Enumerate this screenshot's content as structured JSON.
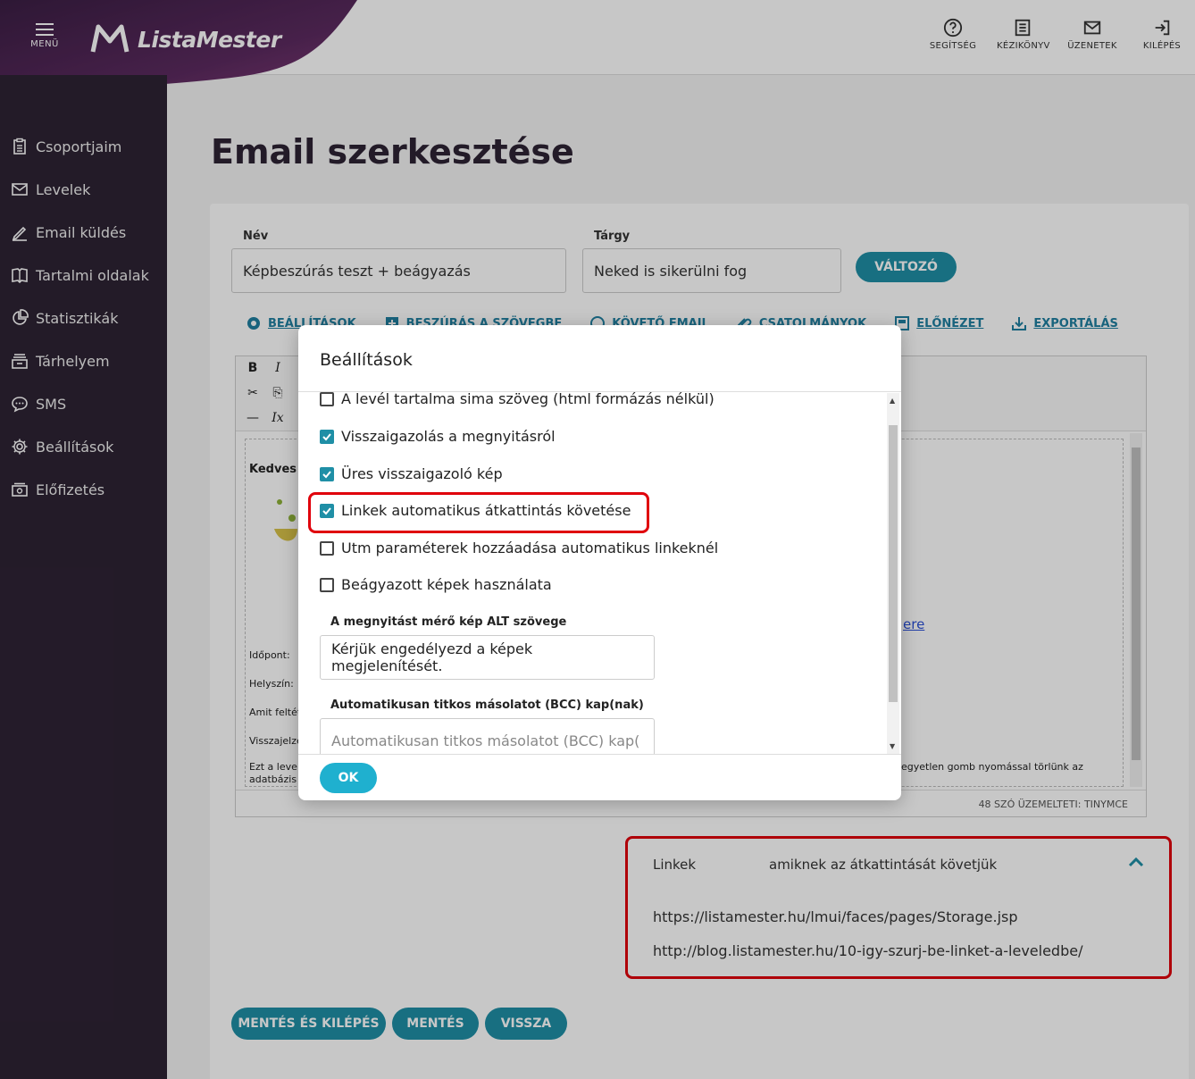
{
  "header": {
    "menu_label": "MENÜ",
    "brand": "ListaMester",
    "actions": [
      {
        "label": "SEGÍTSÉG",
        "icon": "help-icon"
      },
      {
        "label": "KÉZIKÖNYV",
        "icon": "manual-icon"
      },
      {
        "label": "ÜZENETEK",
        "icon": "messages-icon"
      },
      {
        "label": "KILÉPÉS",
        "icon": "logout-icon"
      }
    ]
  },
  "sidebar": {
    "items": [
      {
        "label": "Csoportjaim",
        "icon": "clipboard-icon"
      },
      {
        "label": "Levelek",
        "icon": "mail-icon"
      },
      {
        "label": "Email küldés",
        "icon": "pen-icon"
      },
      {
        "label": "Tartalmi oldalak",
        "icon": "book-icon"
      },
      {
        "label": "Statisztikák",
        "icon": "pie-chart-icon"
      },
      {
        "label": "Tárhelyem",
        "icon": "storage-icon"
      },
      {
        "label": "SMS",
        "icon": "chat-icon"
      },
      {
        "label": "Beállítások",
        "icon": "gear-icon"
      },
      {
        "label": "Előfizetés",
        "icon": "cash-icon"
      }
    ]
  },
  "main": {
    "title": "Email szerkesztése",
    "name_label": "Név",
    "name_value": "Képbeszúrás teszt + beágyazás",
    "subject_label": "Tárgy",
    "subject_value": "Neked is sikerülni fog",
    "variable_button": "VÁLTOZÓ",
    "tabs": [
      {
        "label": "BEÁLLÍTÁSOK",
        "icon": "gear-icon"
      },
      {
        "label": "BESZÚRÁS A SZÖVEGBE",
        "icon": "insert-icon"
      },
      {
        "label": "KÖVETŐ EMAIL",
        "icon": "follow-icon"
      },
      {
        "label": "CSATOLMÁNYOK",
        "icon": "attachment-icon"
      },
      {
        "label": "ELŐNÉZET",
        "icon": "preview-icon"
      },
      {
        "label": "EXPORTÁLÁS",
        "icon": "export-icon"
      }
    ],
    "editor": {
      "greeting": "Kedves [",
      "lines": [
        "Időpont:",
        "Helyszín:",
        "Amit feltét",
        "Visszajelzé"
      ],
      "footer_left": "Ezt a leve",
      "footer_left2": "adatbázis",
      "footer_right": "egyetlen gomb nyomással törlünk az",
      "link_fragment": "ere",
      "status": "48 SZÓ ÜZEMELTETI: TINYMCE"
    },
    "links_panel": {
      "title": "Linkek",
      "subtitle": "amiknek az átkattintását követjük",
      "urls": [
        "https://listamester.hu/lmui/faces/pages/Storage.jsp",
        "http://blog.listamester.hu/10-igy-szurj-be-linket-a-leveledbe/"
      ]
    },
    "buttons": {
      "save_exit": "MENTÉS ÉS KILÉPÉS",
      "save": "MENTÉS",
      "back": "VISSZA"
    }
  },
  "modal": {
    "title": "Beállítások",
    "options": [
      {
        "label": "A levél tartalma sima szöveg (html formázás nélkül)",
        "checked": false
      },
      {
        "label": "Visszaigazolás a megnyitásról",
        "checked": true
      },
      {
        "label": "Üres visszaigazoló kép",
        "checked": true
      },
      {
        "label": "Linkek automatikus átkattintás követése",
        "checked": true
      },
      {
        "label": "Utm paraméterek hozzáadása automatikus linkeknél",
        "checked": false
      },
      {
        "label": "Beágyazott képek használata",
        "checked": false
      }
    ],
    "alt_label": "A megnyitást mérő kép ALT szövege",
    "alt_value": "Kérjük engedélyezd a képek megjelenítését.",
    "bcc_label": "Automatikusan titkos másolatot (BCC) kap(nak)",
    "bcc_placeholder": "Automatikusan titkos másolatot (BCC) kap(",
    "ok_label": "OK"
  },
  "colors": {
    "brand_purple": "#5b2a5f",
    "sidebar_bg": "#2e2334",
    "accent": "#1f8fa6",
    "highlight_red": "#e0000b"
  }
}
